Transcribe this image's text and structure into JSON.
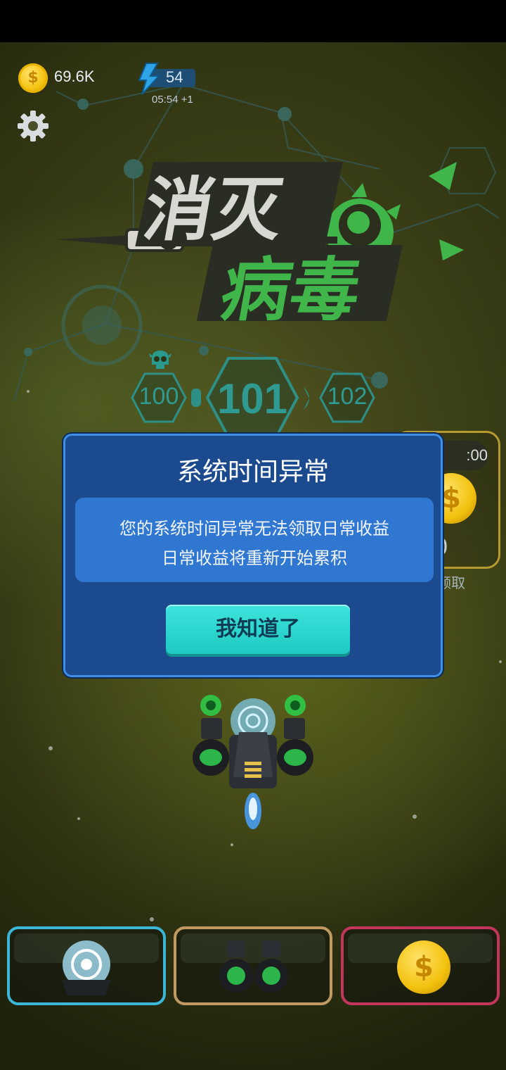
{
  "hud": {
    "coins": "69.6K",
    "energy": "54",
    "energy_timer": "05:54 +1"
  },
  "logo": {
    "line1": "消灭",
    "line2": "病毒"
  },
  "levels": {
    "previous": "100",
    "current": "101",
    "next": "102"
  },
  "reward_panel": {
    "timer_partial": ":00",
    "value_partial": "0",
    "label_partial": "领取"
  },
  "dialog": {
    "title": "系统时间异常",
    "body_line1": "您的系统时间异常无法领取日常收益",
    "body_line2": "日常收益将重新开始累积",
    "ok_label": "我知道了"
  },
  "bottom_tabs": [
    {
      "name": "shield",
      "border_color": "#3cb6d6"
    },
    {
      "name": "turrets",
      "border_color": "#c19a62"
    },
    {
      "name": "coins",
      "border_color": "#c4355c"
    }
  ],
  "colors": {
    "dialog_bg": "#1b4a8e",
    "dialog_border": "#3f8fe6",
    "button": "#1fc9c2",
    "logo_green": "#3fb54a"
  }
}
